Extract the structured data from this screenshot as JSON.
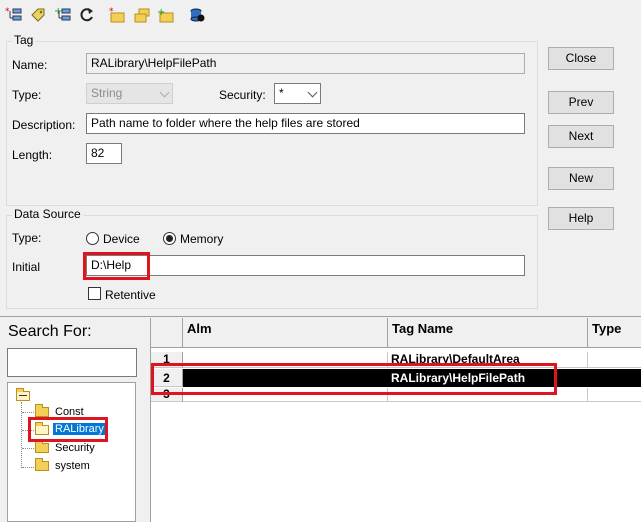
{
  "toolbar": {
    "icons": [
      "new-tag-icon",
      "edit-tag-icon",
      "add-tag-icon",
      "refresh-icon",
      "delete-folder-icon",
      "duplicate-folder-icon",
      "new-folder-icon",
      "database-icon"
    ]
  },
  "tag_group": {
    "legend": "Tag",
    "name_label": "Name:",
    "name_value": "RALibrary\\HelpFilePath",
    "type_label": "Type:",
    "type_value": "String",
    "security_label": "Security:",
    "security_value": "*",
    "description_label": "Description:",
    "description_value": "Path name to folder where the help files are stored",
    "length_label": "Length:",
    "length_value": "82"
  },
  "data_source": {
    "legend": "Data Source",
    "type_label": "Type:",
    "device_label": "Device",
    "memory_label": "Memory",
    "selected": "Memory",
    "initial_label": "Initial",
    "initial_value": "D:\\Help",
    "retentive_label": "Retentive",
    "retentive_checked": false
  },
  "buttons": {
    "close": "Close",
    "prev": "Prev",
    "next": "Next",
    "new": "New",
    "help": "Help"
  },
  "search": {
    "label": "Search For:",
    "value": ""
  },
  "tree": {
    "items": [
      "Const",
      "RALibrary",
      "Security",
      "system"
    ],
    "selected": "RALibrary"
  },
  "grid": {
    "columns": [
      "Alm",
      "Tag Name",
      "Type"
    ],
    "rows": [
      {
        "num": "1",
        "alm": "",
        "tag": "RALibrary\\DefaultArea",
        "type": ""
      },
      {
        "num": "2",
        "alm": "",
        "tag": "RALibrary\\HelpFilePath",
        "type": ""
      },
      {
        "num": "3",
        "alm": "",
        "tag": "",
        "type": ""
      }
    ],
    "selected_row": 2
  },
  "colors": {
    "highlight": "#e0141e",
    "selection": "#000000",
    "folder": "#f3cf55"
  }
}
